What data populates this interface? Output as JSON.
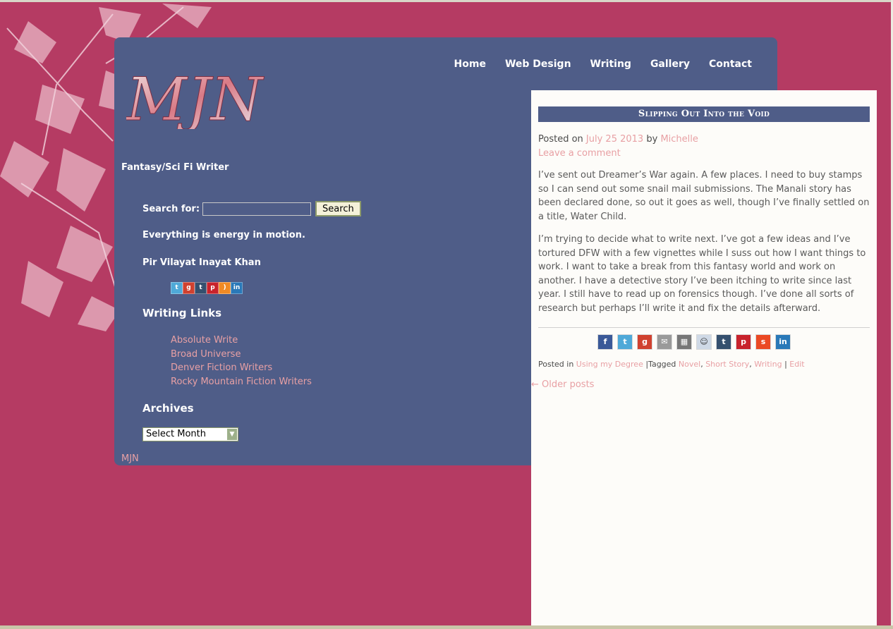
{
  "colors": {
    "page_background": "#b53b63",
    "panel_background": "#4f5d88",
    "content_background": "#fdfcf9",
    "link_color": "#e8a0a4"
  },
  "nav": {
    "items": [
      "Home",
      "Web Design",
      "Writing",
      "Gallery",
      "Contact"
    ]
  },
  "site": {
    "logo_text": "MJN",
    "tagline": "Fantasy/Sci Fi Writer",
    "footer_link": "MJN"
  },
  "sidebar": {
    "search_label": "Search for:",
    "search_value": "",
    "search_button": "Search",
    "quote": "Everything is energy in motion.",
    "quote_author": "Pir Vilayat Inayat Khan",
    "social_icons": [
      "twitter-icon",
      "google-plus-icon",
      "tumblr-icon",
      "pinterest-icon",
      "rss-icon",
      "linkedin-icon"
    ],
    "links_heading": "Writing Links",
    "links": [
      "Absolute Write",
      "Broad Universe",
      "Denver Fiction Writers",
      "Rocky Mountain Fiction Writers"
    ],
    "archives_heading": "Archives",
    "archives_select": "Select Month"
  },
  "post": {
    "title": "Slipping Out Into the Void",
    "posted_on": "Posted on",
    "date": "July 25 2013",
    "by": "by",
    "author": "Michelle",
    "leave_comment": "Leave a comment",
    "paragraphs": [
      "I’ve sent out Dreamer’s War again. A few places. I need to buy stamps so I can send out some snail mail submissions. The Manali story has been declared done, so out it goes as well, though I’ve finally settled on a title, Water Child.",
      "I’m trying to decide what to write next. I’ve got a few ideas and I’ve tortured DFW with a few vignettes while I suss out how I want things to work. I want to take a break from this fantasy world and work on another. I have a detective story I’ve been itching to write since last year. I still have to read up on forensics though. I’ve done all sorts of research but perhaps I’ll write it and fix the details afterward."
    ],
    "share_icons": [
      "facebook-icon",
      "twitter-icon",
      "google-plus-icon",
      "email-icon",
      "delicious-icon",
      "reddit-icon",
      "tumblr-icon",
      "pinterest-icon",
      "stumbleupon-icon",
      "linkedin-icon"
    ],
    "posted_in": "Posted in",
    "category": "Using my Degree",
    "tagged": "|Tagged",
    "tags": [
      "Novel",
      "Short Story",
      "Writing"
    ],
    "separator": "|",
    "edit": "Edit",
    "older_posts": "← Older posts"
  }
}
